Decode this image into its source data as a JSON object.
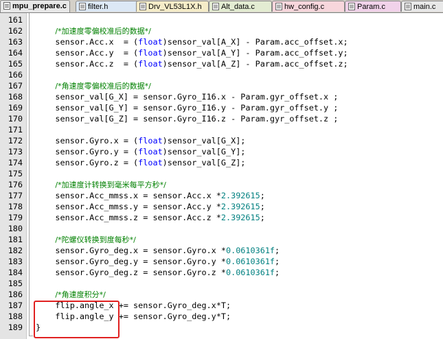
{
  "tabs": [
    {
      "label": "mpu_prepare.c",
      "active": true
    },
    {
      "label": "filter.h"
    },
    {
      "label": "Drv_VL53L1X.h"
    },
    {
      "label": "Alt_data.c"
    },
    {
      "label": "hw_config.c"
    },
    {
      "label": "Param.c"
    },
    {
      "label": "main.c"
    }
  ],
  "lines": [
    {
      "n": "161",
      "segs": []
    },
    {
      "n": "162",
      "segs": [
        {
          "t": "    "
        },
        {
          "t": "/*加速度零偏校准后的数据*/",
          "c": "cmt cn"
        }
      ]
    },
    {
      "n": "163",
      "segs": [
        {
          "t": "    sensor.Acc.x  = ("
        },
        {
          "t": "float",
          "c": "kw"
        },
        {
          "t": ")sensor_val[A_X] - Param.acc_offset.x;"
        }
      ]
    },
    {
      "n": "164",
      "segs": [
        {
          "t": "    sensor.Acc.y  = ("
        },
        {
          "t": "float",
          "c": "kw"
        },
        {
          "t": ")sensor_val[A_Y] - Param.acc_offset.y;"
        }
      ]
    },
    {
      "n": "165",
      "segs": [
        {
          "t": "    sensor.Acc.z  = ("
        },
        {
          "t": "float",
          "c": "kw"
        },
        {
          "t": ")sensor_val[A_Z] - Param.acc_offset.z;"
        }
      ]
    },
    {
      "n": "166",
      "segs": []
    },
    {
      "n": "167",
      "segs": [
        {
          "t": "    "
        },
        {
          "t": "/*角速度零偏校准后的数据*/",
          "c": "cmt cn"
        }
      ]
    },
    {
      "n": "168",
      "segs": [
        {
          "t": "    sensor_val[G_X] = sensor.Gyro_I16.x - Param.gyr_offset.x ;"
        }
      ]
    },
    {
      "n": "169",
      "segs": [
        {
          "t": "    sensor_val[G_Y] = sensor.Gyro_I16.y - Param.gyr_offset.y ;"
        }
      ]
    },
    {
      "n": "170",
      "segs": [
        {
          "t": "    sensor_val[G_Z] = sensor.Gyro_I16.z - Param.gyr_offset.z ;"
        }
      ]
    },
    {
      "n": "171",
      "segs": []
    },
    {
      "n": "172",
      "segs": [
        {
          "t": "    sensor.Gyro.x = ("
        },
        {
          "t": "float",
          "c": "kw"
        },
        {
          "t": ")sensor_val[G_X];"
        }
      ]
    },
    {
      "n": "173",
      "segs": [
        {
          "t": "    sensor.Gyro.y = ("
        },
        {
          "t": "float",
          "c": "kw"
        },
        {
          "t": ")sensor_val[G_Y];"
        }
      ]
    },
    {
      "n": "174",
      "segs": [
        {
          "t": "    sensor.Gyro.z = ("
        },
        {
          "t": "float",
          "c": "kw"
        },
        {
          "t": ")sensor_val[G_Z];"
        }
      ]
    },
    {
      "n": "175",
      "segs": []
    },
    {
      "n": "176",
      "segs": [
        {
          "t": "    "
        },
        {
          "t": "/*加速度计转换到毫米每平方秒*/",
          "c": "cmt cn"
        }
      ]
    },
    {
      "n": "177",
      "segs": [
        {
          "t": "    sensor.Acc_mmss.x = sensor.Acc.x *"
        },
        {
          "t": "2.392615",
          "c": "num"
        },
        {
          "t": ";"
        }
      ]
    },
    {
      "n": "178",
      "segs": [
        {
          "t": "    sensor.Acc_mmss.y = sensor.Acc.y *"
        },
        {
          "t": "2.392615",
          "c": "num"
        },
        {
          "t": ";"
        }
      ]
    },
    {
      "n": "179",
      "segs": [
        {
          "t": "    sensor.Acc_mmss.z = sensor.Acc.z *"
        },
        {
          "t": "2.392615",
          "c": "num"
        },
        {
          "t": ";"
        }
      ]
    },
    {
      "n": "180",
      "segs": []
    },
    {
      "n": "181",
      "segs": [
        {
          "t": "    "
        },
        {
          "t": "/*陀螺仪转换到度每秒*/",
          "c": "cmt cn"
        }
      ]
    },
    {
      "n": "182",
      "segs": [
        {
          "t": "    sensor.Gyro_deg.x = sensor.Gyro.x *"
        },
        {
          "t": "0.0610361f",
          "c": "num"
        },
        {
          "t": ";"
        }
      ]
    },
    {
      "n": "183",
      "segs": [
        {
          "t": "    sensor.Gyro_deg.y = sensor.Gyro.y *"
        },
        {
          "t": "0.0610361f",
          "c": "num"
        },
        {
          "t": ";"
        }
      ]
    },
    {
      "n": "184",
      "segs": [
        {
          "t": "    sensor.Gyro_deg.z = sensor.Gyro.z *"
        },
        {
          "t": "0.0610361f",
          "c": "num"
        },
        {
          "t": ";"
        }
      ]
    },
    {
      "n": "185",
      "segs": []
    },
    {
      "n": "186",
      "segs": [
        {
          "t": "    "
        },
        {
          "t": "/*角速度积分*/",
          "c": "cmt cn"
        }
      ]
    },
    {
      "n": "187",
      "segs": [
        {
          "t": "    flip.angle_x += sensor.Gyro_deg.x*T;"
        }
      ]
    },
    {
      "n": "188",
      "segs": [
        {
          "t": "    flip.angle_y += sensor.Gyro_deg.y*T;"
        }
      ]
    },
    {
      "n": "189",
      "segs": [
        {
          "t": "}"
        }
      ]
    }
  ]
}
